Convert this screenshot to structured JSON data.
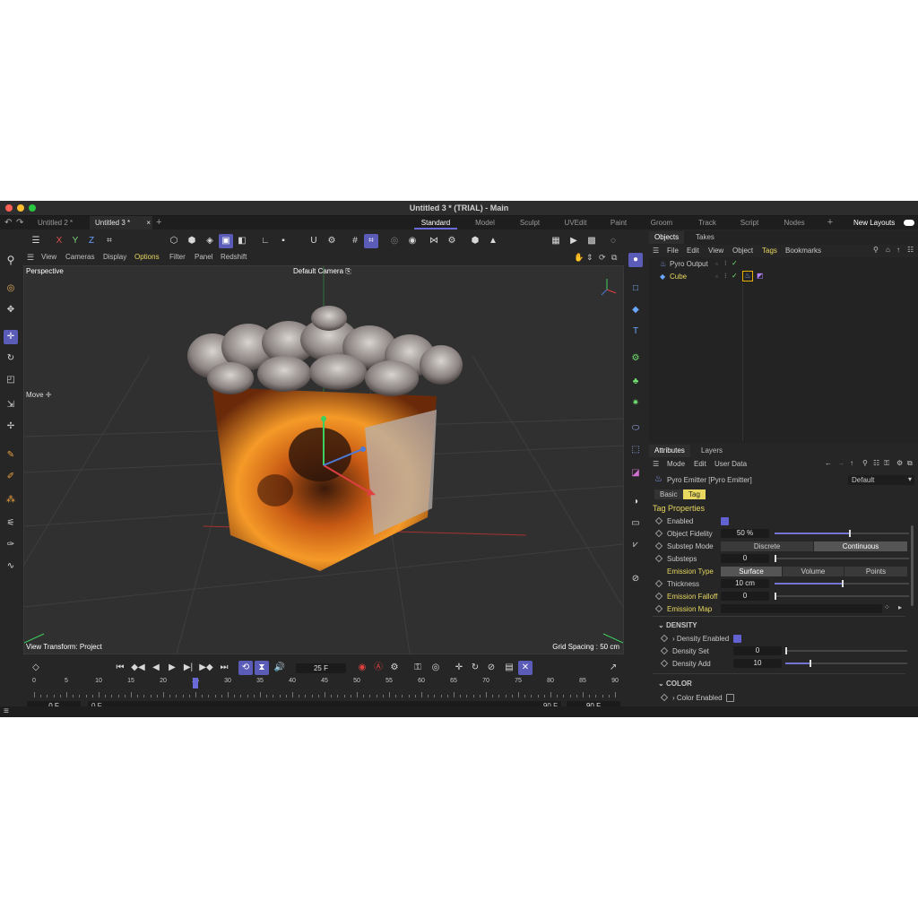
{
  "window": {
    "title": "Untitled 3 * (TRIAL) - Main"
  },
  "doc_tabs": [
    {
      "label": "Untitled 2 *",
      "active": false
    },
    {
      "label": "Untitled 3 *",
      "active": true,
      "close": "×"
    },
    {
      "label": "+"
    }
  ],
  "layout_tabs": [
    "Standard",
    "Model",
    "Sculpt",
    "UVEdit",
    "Paint",
    "Groom",
    "Track",
    "Script",
    "Nodes",
    "+"
  ],
  "new_layouts": "New Layouts",
  "coord_axes": [
    "X",
    "Y",
    "Z"
  ],
  "viewport_menu": [
    "View",
    "Cameras",
    "Display",
    "Options",
    "Filter",
    "Panel",
    "Redshift"
  ],
  "viewport": {
    "view_name": "Perspective",
    "camera": "Default Camera",
    "hud_move": "Move",
    "view_transform": "View Transform: Project",
    "grid_spacing": "Grid Spacing : 50 cm"
  },
  "objects_panel": {
    "tabs": [
      "Objects",
      "Takes"
    ],
    "menu": [
      "File",
      "Edit",
      "View",
      "Object",
      "Tags",
      "Bookmarks"
    ],
    "items": [
      {
        "name": "Pyro Output",
        "color": "#c8c8c8"
      },
      {
        "name": "Cube",
        "color": "#e8d860"
      }
    ]
  },
  "attributes": {
    "tabs": [
      "Attributes",
      "Layers"
    ],
    "menu": [
      "Mode",
      "Edit",
      "User Data"
    ],
    "object_label": "Pyro Emitter [Pyro Emitter]",
    "preset": "Default",
    "subtabs": [
      "Basic",
      "Tag"
    ],
    "section": "Tag Properties",
    "enabled_label": "Enabled",
    "object_fidelity": {
      "label": "Object Fidelity",
      "value": "50 %",
      "fraction": 0.55
    },
    "substep_mode": {
      "label": "Substep Mode",
      "options": [
        "Discrete",
        "Continuous"
      ],
      "selected": "Continuous"
    },
    "substeps": {
      "label": "Substeps",
      "value": "0"
    },
    "emission_type": {
      "label": "Emission Type",
      "options": [
        "Surface",
        "Volume",
        "Points"
      ],
      "selected": "Surface"
    },
    "thickness": {
      "label": "Thickness",
      "value": "10 cm",
      "fraction": 0.5
    },
    "emission_falloff": {
      "label": "Emission Falloff",
      "value": "0"
    },
    "emission_map": {
      "label": "Emission Map"
    },
    "density": {
      "header": "DENSITY",
      "enabled_label": "Density Enabled",
      "set_label": "Density Set",
      "set_value": "0",
      "add_label": "Density Add",
      "add_value": "10",
      "add_fraction": 0.2
    },
    "color": {
      "header": "COLOR",
      "enabled_label": "Color Enabled"
    }
  },
  "timeline": {
    "current_frame": "25 F",
    "ticks": [
      "0",
      "5",
      "10",
      "15",
      "20",
      "25",
      "30",
      "35",
      "40",
      "45",
      "50",
      "55",
      "60",
      "65",
      "70",
      "75",
      "80",
      "85",
      "90"
    ],
    "start": "0 F",
    "range_start": "0 F",
    "range_end": "90 F",
    "end": "90 F",
    "playhead_frame": 25
  },
  "colors": {
    "accent": "#5b5bb8",
    "yellow": "#e8d860",
    "bg": "#262626"
  }
}
